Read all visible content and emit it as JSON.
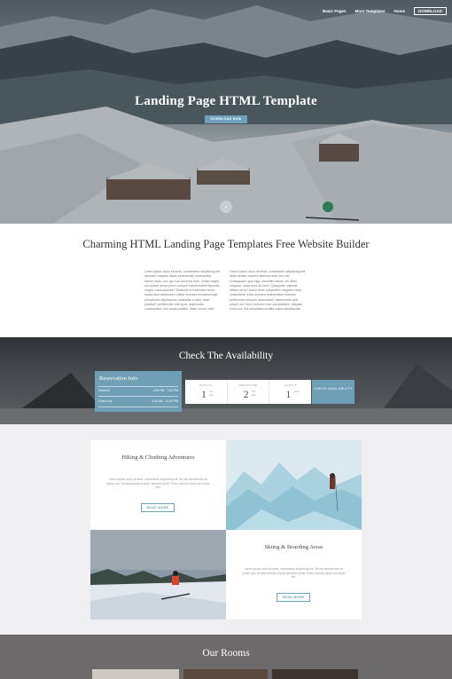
{
  "nav": {
    "items": [
      "Basic Pages",
      "More Templates",
      "Home"
    ],
    "download": "DOWNLOAD"
  },
  "hero": {
    "title": "Landing Page HTML Template",
    "button": "DOWNLOAD NOW",
    "scroll_icon": "chevron-down-icon"
  },
  "intro": {
    "title": "Charming HTML Landing Page Templates Free Website Builder",
    "col1": "Lorem ipsum dolor sit amet, consectetur adipisicing elit. Aperiam voluptas atque perferendis consequatur labore modi, cum qui, non ducimus eum, soluta magni sed potest ipsum porro cumque reprehenderit flavoritis, magni, consequuntur? Distinctio in molestias rerum itaque eius laboriosam ultime nesciunt excepturi fugit perspiciatis dignissimos molestiae a nulla, esse pariatur? perferendis velit quod, aspernatur consequatur. non turpis porttitor, dicta, iusum, nam.",
    "col2": "Lorem ipsum dolor sit amet, consectetur adipisicing elit. Nulla debitis maiores delectus eum sed nisi, consequatur quis fuga, blanditiis minus, vel ullam voluptas, natus sunt ab hero? Quisquam, placeat, officiis porro? ipsum dolor voluptatem magnam nulla consectetur, enim dolorem praesentium maiores perferendis tempore aspernatur? assumenda sint! eaque non, enim dolorem eum accusantium, aliquam enim iure. Aut voluptates mollitia culpa repudiandae."
  },
  "availability": {
    "title": "Check The Availability",
    "reservation_title": "Reservation Info",
    "check_in_label": "Check in",
    "check_in_time": "2:00 PM - 7:00 PM",
    "check_out_label": "Check out",
    "check_out_time": "2:00 AM - 11:00 PM",
    "fields": [
      {
        "label": "ARRIVAL",
        "value": "1",
        "sub": "Oct\nSun"
      },
      {
        "label": "DEPARTURE",
        "value": "2",
        "sub": "Oct\nMon"
      },
      {
        "label": "GUESTS",
        "value": "1",
        "sub": "Adult"
      }
    ],
    "check_button": "CHECK AVAILABILITY"
  },
  "activities": {
    "hiking": {
      "title": "Hiking & Climbing Adventures",
      "text": "Lorem ipsum dolor sit amet, consectetur adipisicing elit. Tel nisi repellendus vel ipsum quo, sit assumenda corporis tempore quasi! Tellus rhoncus turpis vel neque nisi.",
      "button": "READ MORE"
    },
    "skiing": {
      "title": "Skiing & Boarding Areas",
      "text": "Lorem ipsum dolor sit amet, consectetur adipisicing elit. Tel nisi repellendus vel ipsum quo, sit assumenda corporis tempore quasi! Tellus rhoncus turpis vel neque nisi.",
      "button": "READ MORE"
    }
  },
  "rooms": {
    "title": "Our Rooms"
  },
  "colors": {
    "accent": "#6f9fb5",
    "rooms_bg": "#6d6a6c",
    "page_bg": "#efeef0"
  }
}
